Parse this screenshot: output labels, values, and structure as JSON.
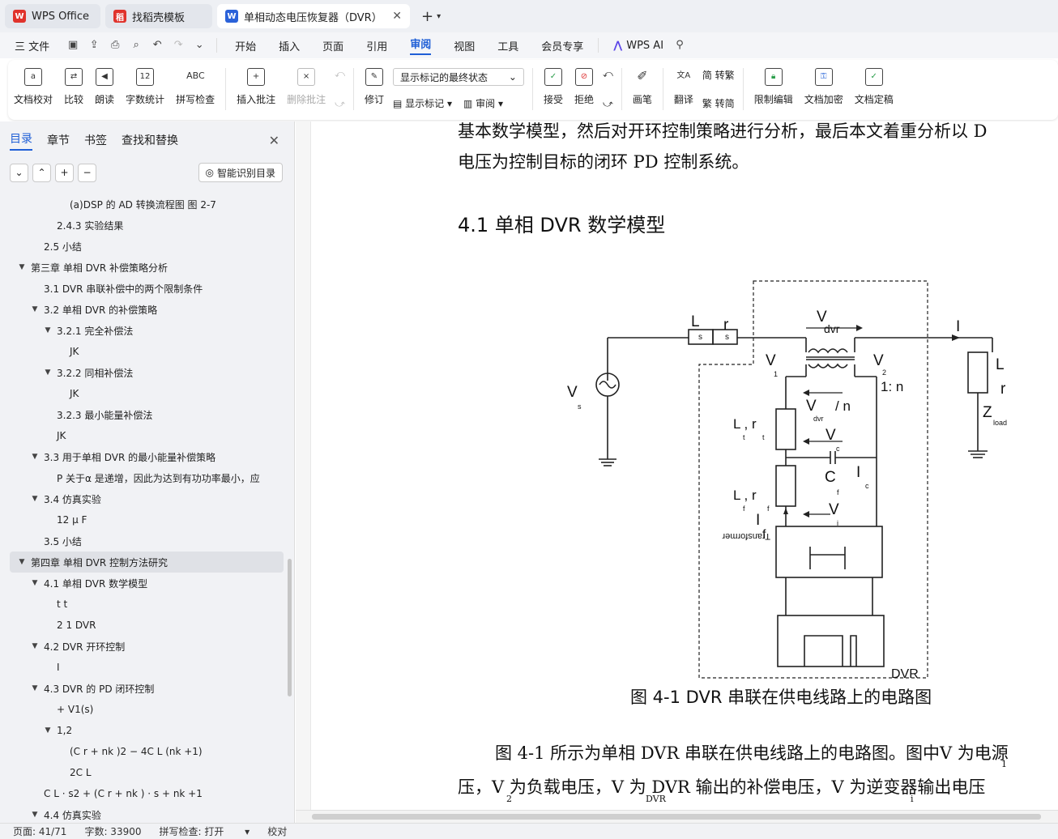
{
  "tabs": [
    {
      "label": "WPS Office",
      "logo": "W"
    },
    {
      "label": "找稻壳模板",
      "logo": "稻"
    },
    {
      "label": "单相动态电压恢复器（DVR）€",
      "logo": "W"
    }
  ],
  "menubar": {
    "file": "三 文件",
    "menus": [
      "开始",
      "插入",
      "页面",
      "引用",
      "审阅",
      "视图",
      "工具",
      "会员专享"
    ],
    "active": "审阅",
    "ai": "WPS AI"
  },
  "ribbon": {
    "doc_check": "文档校对",
    "compare": "比较",
    "read": "朗读",
    "word_count": "字数统计",
    "spell_check": "拼写检查",
    "insert_comment": "插入批注",
    "delete_comment": "删除批注",
    "revise": "修订",
    "show_mode": "显示标记的最终状态",
    "show_marks": "显示标记",
    "review": "审阅",
    "accept": "接受",
    "reject": "拒绝",
    "pen": "画笔",
    "translate": "翻译",
    "to_traditional": "转繁",
    "to_simplified": "转简",
    "restrict_edit": "限制编辑",
    "encrypt": "文档加密",
    "finalize": "文档定稿"
  },
  "sidebar": {
    "tabs": [
      "目录",
      "章节",
      "书签",
      "查找和替换"
    ],
    "smart_toc": "智能识别目录",
    "toc": [
      {
        "label": "(a)DSP 的 AD 转换流程图  图 2-7",
        "level": 3,
        "arrow": false
      },
      {
        "label": "2.4.3 实验结果",
        "level": 2,
        "arrow": false
      },
      {
        "label": "2.5 小结",
        "level": 1,
        "arrow": false
      },
      {
        "label": "第三章  单相 DVR 补偿策略分析",
        "level": 0,
        "arrow": true
      },
      {
        "label": "3.1 DVR 串联补偿中的两个限制条件",
        "level": 1,
        "arrow": false
      },
      {
        "label": "3.2 单相 DVR 的补偿策略",
        "level": 1,
        "arrow": true
      },
      {
        "label": "3.2.1 完全补偿法",
        "level": 2,
        "arrow": true
      },
      {
        "label": "JK",
        "level": 3,
        "arrow": false
      },
      {
        "label": "3.2.2 同相补偿法",
        "level": 2,
        "arrow": true
      },
      {
        "label": "JK",
        "level": 3,
        "arrow": false
      },
      {
        "label": "3.2.3 最小能量补偿法",
        "level": 2,
        "arrow": false
      },
      {
        "label": "JK",
        "level": 0.5,
        "arrow": false
      },
      {
        "label": "3.3 用于单相 DVR 的最小能量补偿策略",
        "level": 1,
        "arrow": true
      },
      {
        "label": "P    关于α 是递增，因此为达到有功功率最小，应",
        "level": 2,
        "arrow": false
      },
      {
        "label": "3.4 仿真实验",
        "level": 1,
        "arrow": true
      },
      {
        "label": "12 μ F",
        "level": 2,
        "arrow": false
      },
      {
        "label": "3.5 小结",
        "level": 1,
        "arrow": false
      },
      {
        "label": "第四章  单相 DVR 控制方法研究",
        "level": 0,
        "arrow": true,
        "active": true
      },
      {
        "label": "4.1 单相 DVR 数学模型",
        "level": 1,
        "arrow": true
      },
      {
        "label": "t     t",
        "level": 2,
        "arrow": false
      },
      {
        "label": "2          1         DVR",
        "level": 2,
        "arrow": false
      },
      {
        "label": "4.2 DVR 开环控制",
        "level": 1,
        "arrow": true
      },
      {
        "label": "I",
        "level": 2,
        "arrow": false
      },
      {
        "label": "4.3 DVR 的 PD 闭环控制",
        "level": 1,
        "arrow": true
      },
      {
        "label": "+    V1(s)",
        "level": 2,
        "arrow": false
      },
      {
        "label": "1,2",
        "level": 2,
        "arrow": true
      },
      {
        "label": "(C r  + nk )2 − 4C L (nk  +1)",
        "level": 3,
        "arrow": false
      },
      {
        "label": "2C L",
        "level": 3,
        "arrow": false
      },
      {
        "label": "C L  · s2 + (C r  + nk ) · s + nk  +1",
        "level": 1,
        "arrow": false
      },
      {
        "label": "4.4 仿真实验",
        "level": 1,
        "arrow": true
      }
    ]
  },
  "document": {
    "line1": "基本数学模型，然后对开环控制策略进行分析，最后本文着重分析以  D",
    "line2": "电压为控制目标的闭环  PD 控制系统。",
    "heading": "4.1 单相 DVR 数学模型",
    "caption": "图 4-1 DVR 串联在供电线路上的电路图",
    "para1": "图  4-1 所示为单相  DVR 串联在供电线路上的电路图。图中V  为电源",
    "para2": "压，V 为负载电压，V     为  DVR 输出的补偿电压，V 为逆变器输出电压",
    "sub1": "1",
    "sub2": "2",
    "sub_dvr": "DVR",
    "sub_i": "i",
    "circuit_labels": {
      "Ls": "L",
      "rs": "r",
      "s_sub": "s",
      "Vdvr": "V",
      "dvr": "dvr",
      "I": "I",
      "Il": "l",
      "Vs": "V",
      "V1": "V",
      "one": "1",
      "V2": "V",
      "two": "2",
      "ratio": "1: n",
      "L": "L",
      "l": "l",
      "r": "r",
      "Z": "Z",
      "load": "load",
      "Vdvr_n": "V",
      "slash_n": "/ n",
      "Ltrt": "L , r",
      "t": "t",
      "Vc": "V",
      "c": "c",
      "Cf": "C",
      "f": "f",
      "Ic": "I",
      "Lfrf": "L , r",
      "Vi": "V",
      "i": "i",
      "If": "I",
      "transformer": "Transformer",
      "dvr_box": "DVR"
    }
  },
  "status": {
    "page": "页面: 41/71",
    "words": "字数: 33900",
    "spell": "拼写检查: 打开",
    "proof": "校对"
  },
  "colors": {
    "accent": "#1f5fd6",
    "wps_red": "#e0332c"
  }
}
